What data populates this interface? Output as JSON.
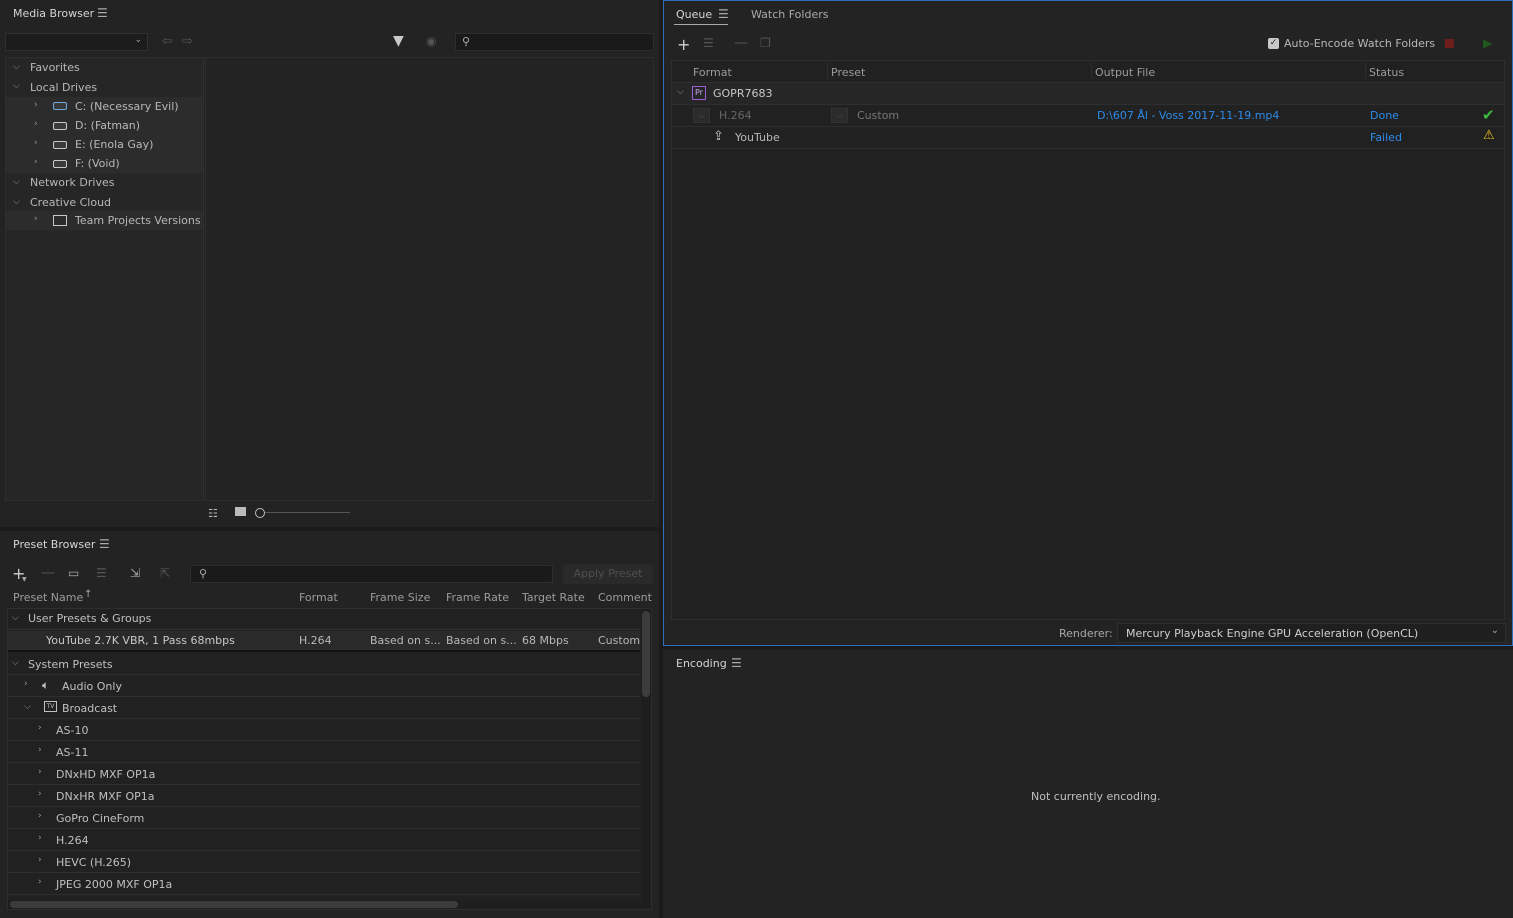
{
  "media_browser": {
    "title": "Media Browser",
    "tree": [
      {
        "label": "Favorites"
      },
      {
        "label": "Local Drives"
      },
      {
        "label": "C: (Necessary Evil)"
      },
      {
        "label": "D: (Fatman)"
      },
      {
        "label": "E: (Enola Gay)"
      },
      {
        "label": "F: (Void)"
      },
      {
        "label": "Network Drives"
      },
      {
        "label": "Creative Cloud"
      },
      {
        "label": "Team Projects Versions"
      }
    ]
  },
  "queue": {
    "tabs": [
      "Queue",
      "Watch Folders"
    ],
    "auto_encode_label": "Auto-Encode Watch Folders",
    "columns": [
      "Format",
      "Preset",
      "Output File",
      "Status"
    ],
    "item_name": "GOPR7683",
    "item_badge": "Pr",
    "rows": [
      {
        "format": "H.264",
        "preset": "Custom",
        "output": "D:\\607 Ål - Voss 2017-11-19.mp4",
        "status": "Done"
      },
      {
        "format": "YouTube",
        "preset": "",
        "output": "",
        "status": "Failed"
      }
    ],
    "renderer_label": "Renderer:",
    "renderer_value": "Mercury Playback Engine GPU Acceleration (OpenCL)"
  },
  "preset_browser": {
    "title": "Preset Browser",
    "apply_label": "Apply Preset",
    "columns": [
      "Preset Name",
      "Format",
      "Frame Size",
      "Frame Rate",
      "Target Rate",
      "Comment"
    ],
    "user_group": "User Presets & Groups",
    "user_preset": {
      "name": "YouTube 2.7K VBR, 1 Pass 68mbps",
      "format": "H.264",
      "frame_size": "Based on s...",
      "frame_rate": "Based on s...",
      "target_rate": "68 Mbps",
      "comment": "Custom"
    },
    "system_group": "System Presets",
    "audio_only": "Audio Only",
    "broadcast": "Broadcast",
    "broadcast_items": [
      "AS-10",
      "AS-11",
      "DNxHD MXF OP1a",
      "DNxHR MXF OP1a",
      "GoPro CineForm",
      "H.264",
      "HEVC (H.265)",
      "JPEG 2000 MXF OP1a"
    ]
  },
  "encoding": {
    "title": "Encoding",
    "status": "Not currently encoding."
  },
  "colors": {
    "accent_blue": "#2d8ceb",
    "done_green": "#3cba3c",
    "warn_yellow": "#e8c21f"
  }
}
